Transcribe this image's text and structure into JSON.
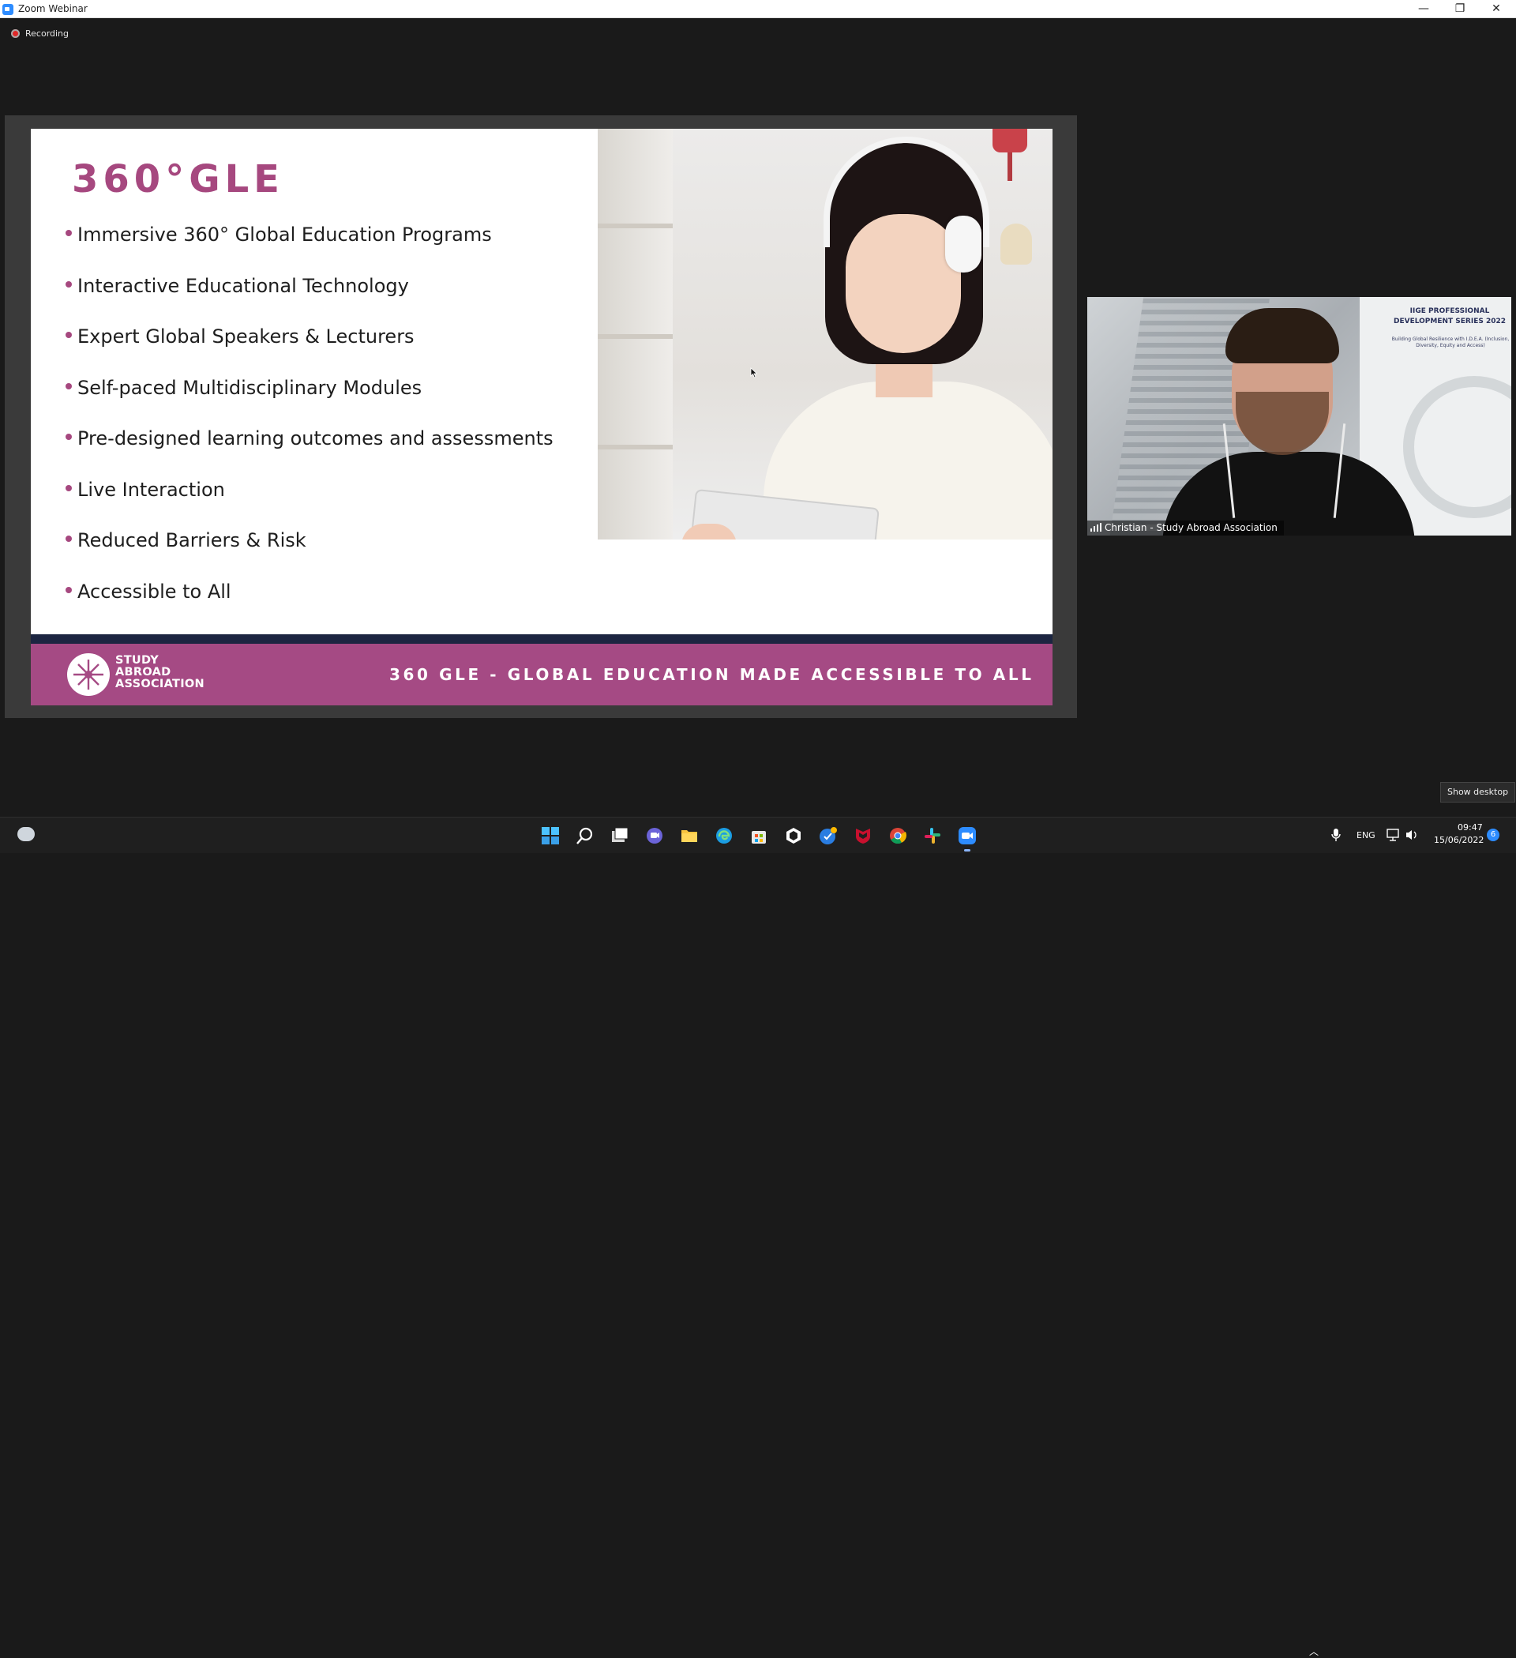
{
  "window": {
    "title": "Zoom Webinar",
    "minimize": "—",
    "maximize": "❐",
    "close": "✕"
  },
  "recording": {
    "label": "Recording"
  },
  "slide": {
    "title": "360°GLE",
    "bullets": [
      "Immersive 360° Global Education Programs",
      "Interactive Educational Technology",
      "Expert Global Speakers & Lecturers",
      "Self-paced Multidisciplinary Modules",
      "Pre-designed learning outcomes and assessments",
      "Live Interaction",
      "Reduced Barriers & Risk",
      "Accessible to All"
    ],
    "logo_lines": [
      "STUDY",
      "ABROAD",
      "ASSOCIATION"
    ],
    "tagline": "360 GLE - GLOBAL EDUCATION MADE ACCESSIBLE TO ALL",
    "device_icons": [
      "vr-headset-icon",
      "smartphone-icon",
      "tablet-icon",
      "laptop-icon",
      "desktop-monitor-icon"
    ],
    "accent_color": "#a6487f",
    "footer_color": "#a54a84",
    "bar_color": "#1c2541"
  },
  "video": {
    "participant_name": "Christian - Study Abroad Association",
    "background_title": "IIGE PROFESSIONAL DEVELOPMENT SERIES 2022",
    "background_subtitle": "Building Global Resilience with I.D.E.A. (Inclusion, Diversity, Equity and Access)"
  },
  "tooltip": {
    "text": "Show desktop"
  },
  "taskbar": {
    "apps": [
      "start-icon",
      "search-icon",
      "task-view-icon",
      "chat-icon",
      "file-explorer-icon",
      "edge-icon",
      "store-icon",
      "app-icon",
      "app-icon-2",
      "mcafee-icon",
      "chrome-icon",
      "slack-icon",
      "zoom-icon"
    ],
    "language": "ENG",
    "time": "09:47",
    "date": "15/06/2022",
    "notification_count": "6"
  }
}
